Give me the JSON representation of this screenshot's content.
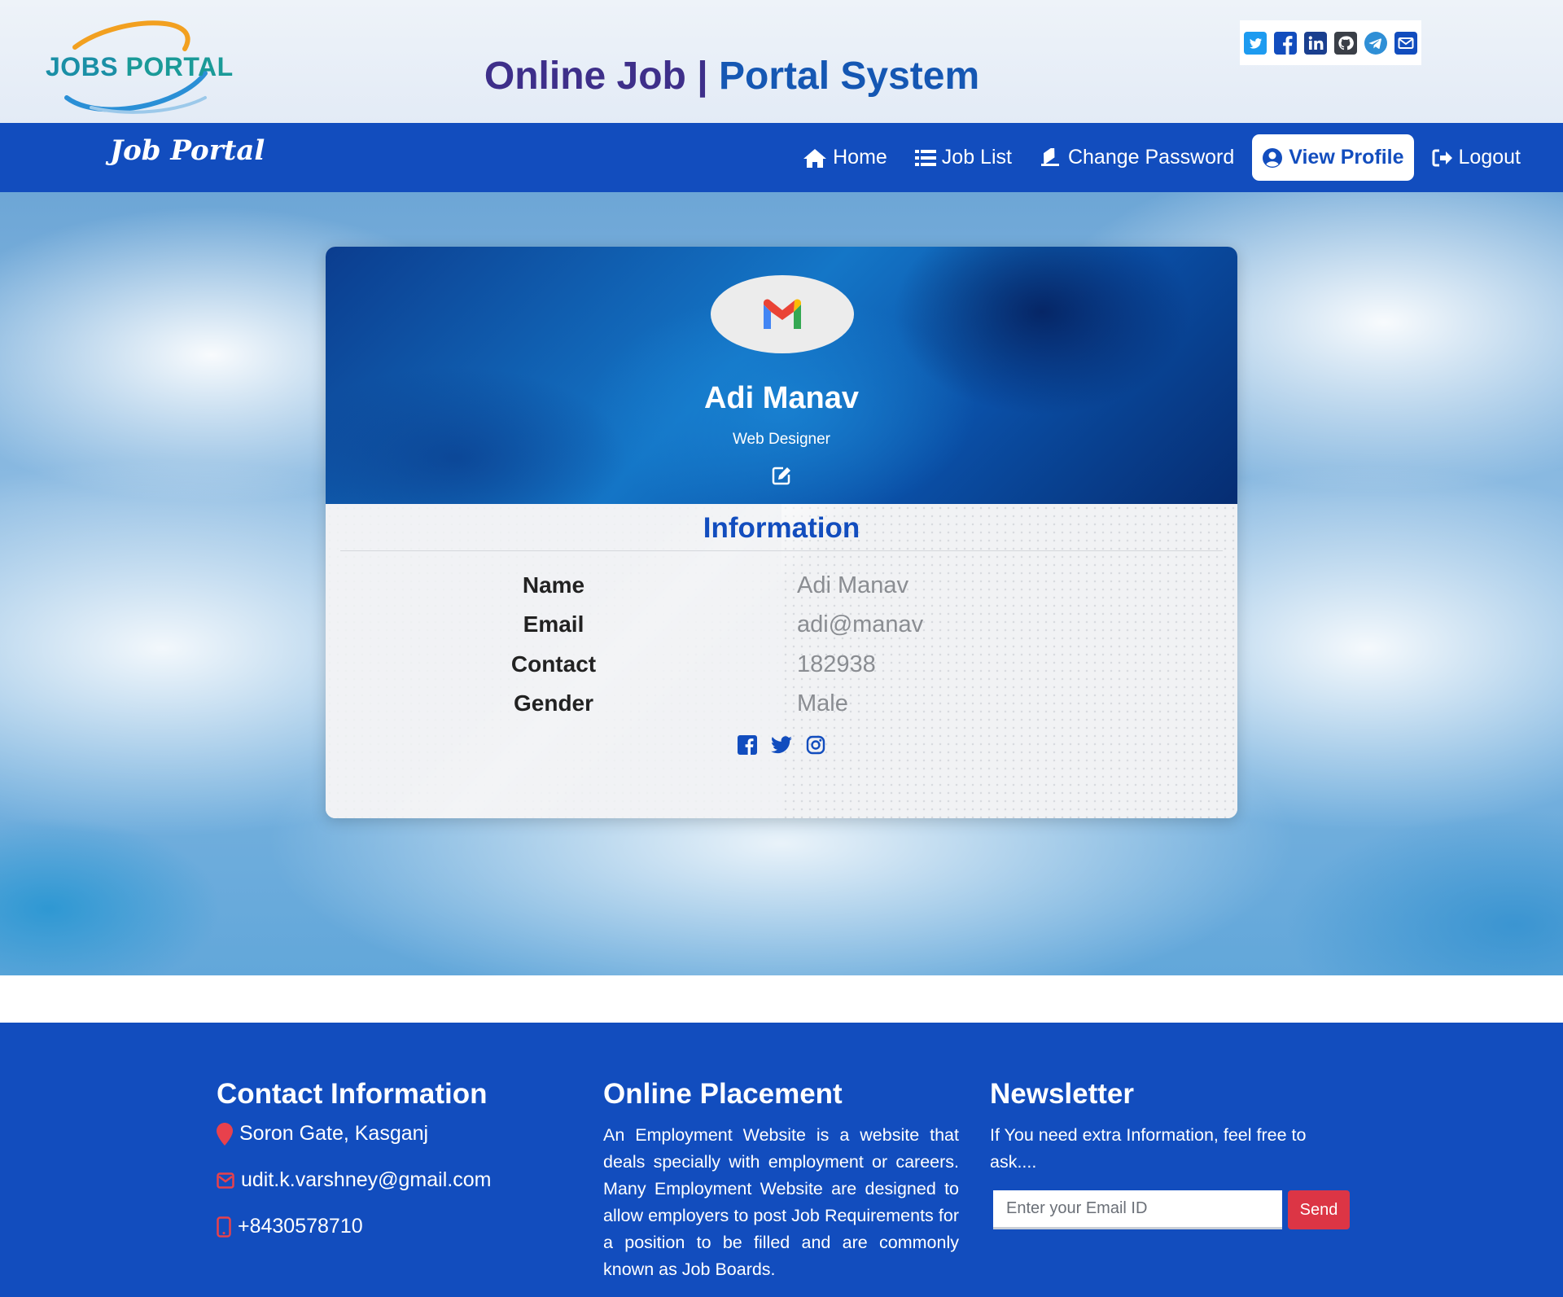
{
  "header": {
    "logo_text_1": "JOBS",
    "logo_text_2": "PORTAL",
    "title_part1": "Online Job",
    "title_separator": "|",
    "title_part2": "Portal System",
    "social_icons": [
      "twitter-icon",
      "facebook-icon",
      "linkedin-icon",
      "github-icon",
      "telegram-icon",
      "envelope-icon"
    ]
  },
  "navbar": {
    "brand": "Job Portal",
    "items": [
      {
        "label": "Home",
        "icon": "home-icon"
      },
      {
        "label": "Job List",
        "icon": "list-icon"
      },
      {
        "label": "Change Password",
        "icon": "eraser-icon"
      },
      {
        "label": "View Profile",
        "icon": "user-circle-icon",
        "active": true
      },
      {
        "label": "Logout",
        "icon": "sign-out-icon"
      }
    ]
  },
  "profile": {
    "avatar_icon": "gmail-icon",
    "name": "Adi Manav",
    "role": "Web Designer",
    "edit_icon": "edit-icon",
    "info_heading": "Information",
    "fields": [
      {
        "label": "Name",
        "value": "Adi Manav"
      },
      {
        "label": "Email",
        "value": "adi@manav"
      },
      {
        "label": "Contact",
        "value": "182938"
      },
      {
        "label": "Gender",
        "value": "Male"
      }
    ],
    "social_icons": [
      "facebook-icon",
      "twitter-icon",
      "instagram-icon"
    ]
  },
  "footer": {
    "contact": {
      "heading": "Contact Information",
      "address": "Soron Gate, Kasganj",
      "email": "udit.k.varshney@gmail.com",
      "phone": "+8430578710"
    },
    "placement": {
      "heading": "Online Placement",
      "text": "An Employment Website is a website that deals specially with employment or careers. Many Employment Website are designed to allow employers to post Job Requirements for a position to be filled and are commonly known as Job Boards."
    },
    "newsletter": {
      "heading": "Newsletter",
      "text": "If You need extra Information, feel free to ask....",
      "input_placeholder": "Enter your Email ID",
      "send_label": "Send"
    }
  },
  "colors": {
    "brand_blue": "#124dbe",
    "title_purple": "#3e2f8a",
    "send_red": "#dc3545",
    "contact_icon_red": "#e8414c"
  }
}
